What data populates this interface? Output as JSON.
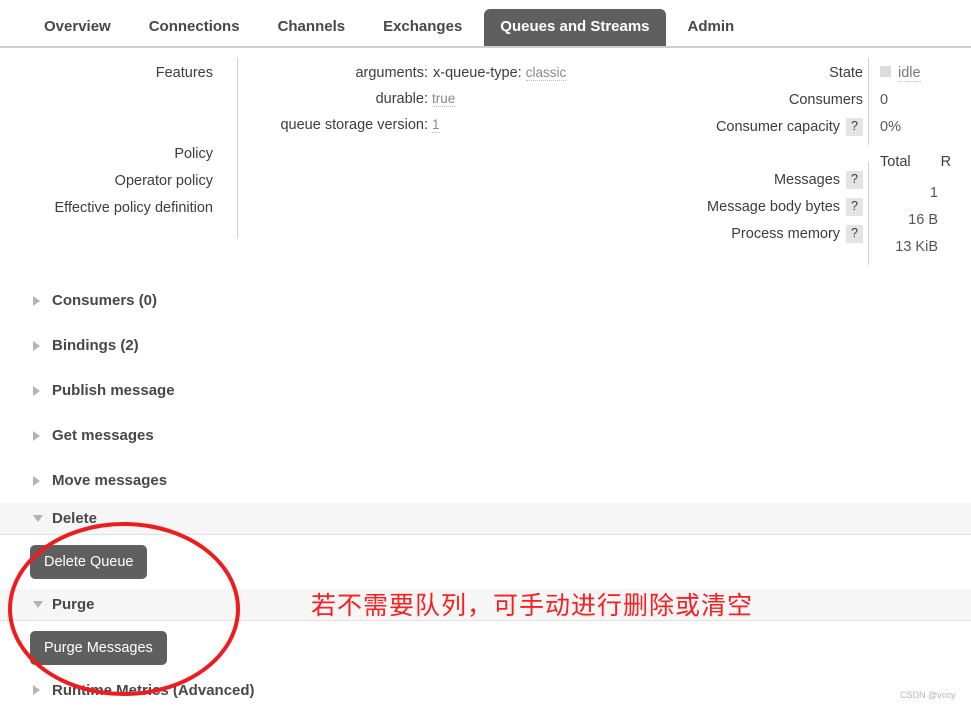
{
  "tabs": [
    {
      "label": "Overview",
      "active": false
    },
    {
      "label": "Connections",
      "active": false
    },
    {
      "label": "Channels",
      "active": false
    },
    {
      "label": "Exchanges",
      "active": false
    },
    {
      "label": "Queues and Streams",
      "active": true
    },
    {
      "label": "Admin",
      "active": false
    }
  ],
  "details": {
    "left_labels": [
      "Features",
      "",
      "",
      "Policy",
      "Operator policy",
      "Effective policy definition"
    ],
    "features": [
      {
        "label": "arguments:",
        "key": "x-queue-type:",
        "value": "classic"
      },
      {
        "label": "durable:",
        "key": "",
        "value": "true"
      },
      {
        "label": "queue storage version:",
        "key": "",
        "value": "1"
      }
    ],
    "stats_top": [
      {
        "label": "State",
        "help": false,
        "value": "idle",
        "swatch": true
      },
      {
        "label": "Consumers",
        "help": false,
        "value": "0",
        "swatch": false
      },
      {
        "label": "Consumer capacity",
        "help": true,
        "value": "0%",
        "swatch": false
      }
    ],
    "table_headers": [
      "Total",
      "R"
    ],
    "stats_bottom": [
      {
        "label": "Messages",
        "help": true,
        "value": "1"
      },
      {
        "label": "Message body bytes",
        "help": true,
        "value": "16 B"
      },
      {
        "label": "Process memory",
        "help": true,
        "value": "13 KiB"
      }
    ],
    "help_glyph": "?"
  },
  "sections": [
    {
      "title": "Consumers (0)",
      "expanded": false,
      "band": false
    },
    {
      "title": "Bindings (2)",
      "expanded": false,
      "band": false
    },
    {
      "title": "Publish message",
      "expanded": false,
      "band": false
    },
    {
      "title": "Get messages",
      "expanded": false,
      "band": false
    },
    {
      "title": "Move messages",
      "expanded": false,
      "band": false
    },
    {
      "title": "Delete",
      "expanded": true,
      "band": true,
      "button": "Delete Queue"
    },
    {
      "title": "Purge",
      "expanded": true,
      "band": true,
      "button": "Purge Messages"
    },
    {
      "title": "Runtime Metrics (Advanced)",
      "expanded": false,
      "band": false
    }
  ],
  "annotation": {
    "text": "若不需要队列，可手动进行删除或清空",
    "color": "#fc1e1e"
  },
  "watermark": "CSDN @vcoy",
  "colors": {
    "active_tab_bg": "#605f5f",
    "button_bg": "#5f5f5f",
    "band_bg": "#f6f6f6",
    "annotation_red": "#fc1e1e",
    "text": "#484848"
  }
}
